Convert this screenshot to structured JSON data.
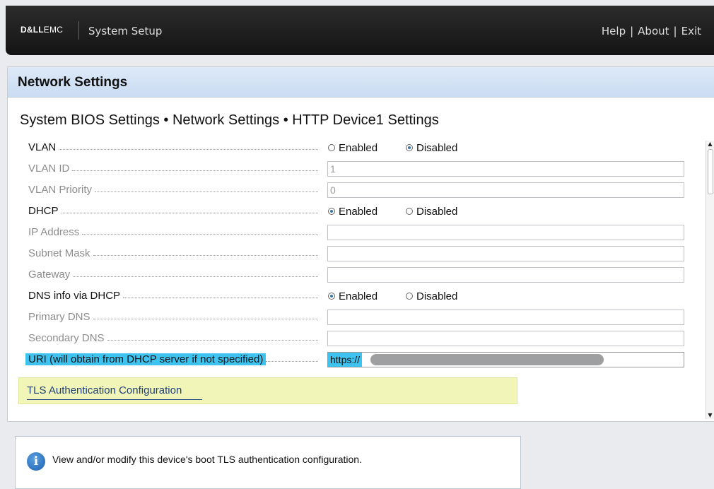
{
  "header": {
    "brand_bold": "D&LL",
    "brand_rest": "EMC",
    "app_title": "System Setup",
    "nav": [
      "Help",
      "About",
      "Exit"
    ],
    "nav_separator": "|"
  },
  "page": {
    "title": "Network Settings",
    "breadcrumb": "System BIOS Settings • Network Settings • HTTP Device1 Settings"
  },
  "form": {
    "vlan": {
      "label": "VLAN",
      "options": [
        "Enabled",
        "Disabled"
      ],
      "selected": "Disabled"
    },
    "vlan_id": {
      "label": "VLAN ID",
      "value": "1"
    },
    "vlan_priority": {
      "label": "VLAN Priority",
      "value": "0"
    },
    "dhcp": {
      "label": "DHCP",
      "options": [
        "Enabled",
        "Disabled"
      ],
      "selected": "Enabled"
    },
    "ip_address": {
      "label": "IP Address",
      "value": ""
    },
    "subnet_mask": {
      "label": "Subnet Mask",
      "value": ""
    },
    "gateway": {
      "label": "Gateway",
      "value": ""
    },
    "dns_via_dhcp": {
      "label": "DNS info via DHCP",
      "options": [
        "Enabled",
        "Disabled"
      ],
      "selected": "Enabled"
    },
    "primary_dns": {
      "label": "Primary DNS",
      "value": ""
    },
    "secondary_dns": {
      "label": "Secondary DNS",
      "value": ""
    },
    "uri": {
      "label": "URI (will obtain from DHCP server if not specified)",
      "value": "https://"
    }
  },
  "tls_link": "TLS Authentication Configuration",
  "info": {
    "icon": "info-icon",
    "text": "View and/or modify this device's boot TLS authentication configuration."
  },
  "colors": {
    "selection": "#3ec3f0",
    "header_bg": "#1a1a1a",
    "title_bar": "#d3e3f5",
    "tls_highlight": "#f1f6b8"
  }
}
